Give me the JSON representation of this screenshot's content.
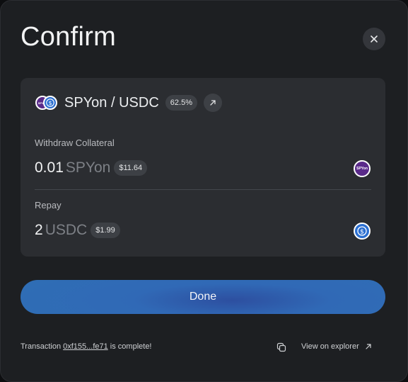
{
  "dialog": {
    "title": "Confirm",
    "close_icon": "close-icon"
  },
  "pair": {
    "name": "SPYon / USDC",
    "ratio_badge": "62.5%",
    "external_link_icon": "arrow-up-right-icon",
    "token_a_icon": "spyon-token-icon",
    "token_a_icon_text": "SPYon",
    "token_b_icon": "usdc-token-icon"
  },
  "withdraw": {
    "label": "Withdraw Collateral",
    "amount": "0.01",
    "symbol": "SPYon",
    "usd_value": "$11.64",
    "token_icon_text": "SPYon"
  },
  "repay": {
    "label": "Repay",
    "amount": "2",
    "symbol": "USDC",
    "usd_value": "$1.99"
  },
  "actions": {
    "done_label": "Done"
  },
  "footer": {
    "tx_prefix": "Transaction",
    "tx_hash": "0xf155...fe71",
    "tx_suffix": "is complete!",
    "copy_icon": "copy-icon",
    "explorer_label": "View on explorer",
    "explorer_icon": "arrow-up-right-icon"
  },
  "colors": {
    "modal_bg": "#1d1f22",
    "card_bg": "#2b2d31",
    "accent_blue": "#2f6db5",
    "usdc_blue": "#2b6fd1",
    "spyon_purple": "#5a2a8a"
  }
}
